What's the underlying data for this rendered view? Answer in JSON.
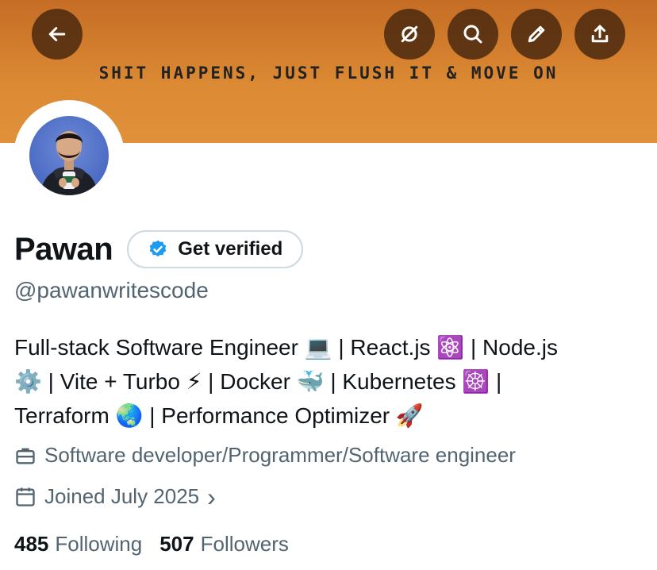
{
  "banner": {
    "text": "SHIT HAPPENS, JUST FLUSH IT & MOVE ON"
  },
  "toolbar": {
    "back": "back-arrow-icon",
    "buttons": [
      "grok-icon",
      "search-icon",
      "edit-pencil-icon",
      "share-icon"
    ]
  },
  "profile": {
    "name": "Pawan",
    "verify_label": "Get verified",
    "handle": "@pawanwritescode",
    "bio_lines": [
      "Full-stack Software Engineer 💻 | React.js ⚛️ | Node.js",
      "⚙️ | Vite + Turbo ⚡ | Docker 🐳 | Kubernetes ☸️ |",
      "Terraform 🌏 | Performance Optimizer 🚀"
    ],
    "profession": "Software developer/Programmer/Software engineer",
    "joined": "Joined July 2025",
    "joined_chevron": "›",
    "following_count": "485",
    "following_label": "Following",
    "followers_count": "507",
    "followers_label": "Followers"
  },
  "colors": {
    "banner": "#dc8a34",
    "verified_blue": "#1d9bf0",
    "secondary_text": "#536471"
  }
}
